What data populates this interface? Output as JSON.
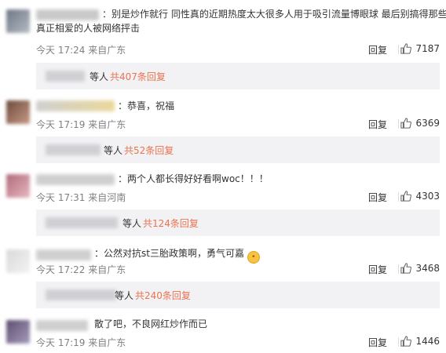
{
  "comments": [
    {
      "text": "：别是炒作就行 同性真的近期热度太大很多人用于吸引流量博眼球 最后别搞得那些",
      "text2": "真正相爱的人被网络抨击",
      "time": "今天 17:24 来自广东",
      "reply": "回复",
      "likes": "7187",
      "sub_who": "等人",
      "sub_more": "共407条回复"
    },
    {
      "text": "：恭喜，祝福",
      "time": "今天 17:19 来自广东",
      "reply": "回复",
      "likes": "6369",
      "sub_who": "等人",
      "sub_more": "共52条回复"
    },
    {
      "text": "：两个人都长得好好看啊woc！！！",
      "time": "今天 17:31 来自河南",
      "reply": "回复",
      "likes": "4303",
      "sub_who": "等人",
      "sub_more": "共124条回复"
    },
    {
      "text": "：公然对抗st三胎政策啊，勇气可嘉",
      "time": "今天 17:22 来自广东",
      "reply": "回复",
      "likes": "3468",
      "sub_who": "等人",
      "sub_more": "共240条回复"
    },
    {
      "text": "散了吧，不良网红炒作而已",
      "time": "今天 17:19 来自广东",
      "reply": "回复",
      "likes": "1446"
    }
  ],
  "colors": {
    "accent": "#eb7350",
    "meta": "#808080",
    "sub_bg": "#f2f2f5"
  },
  "icons": {
    "like": "thumbs-up-icon",
    "emoji": "flushed-face-icon"
  }
}
